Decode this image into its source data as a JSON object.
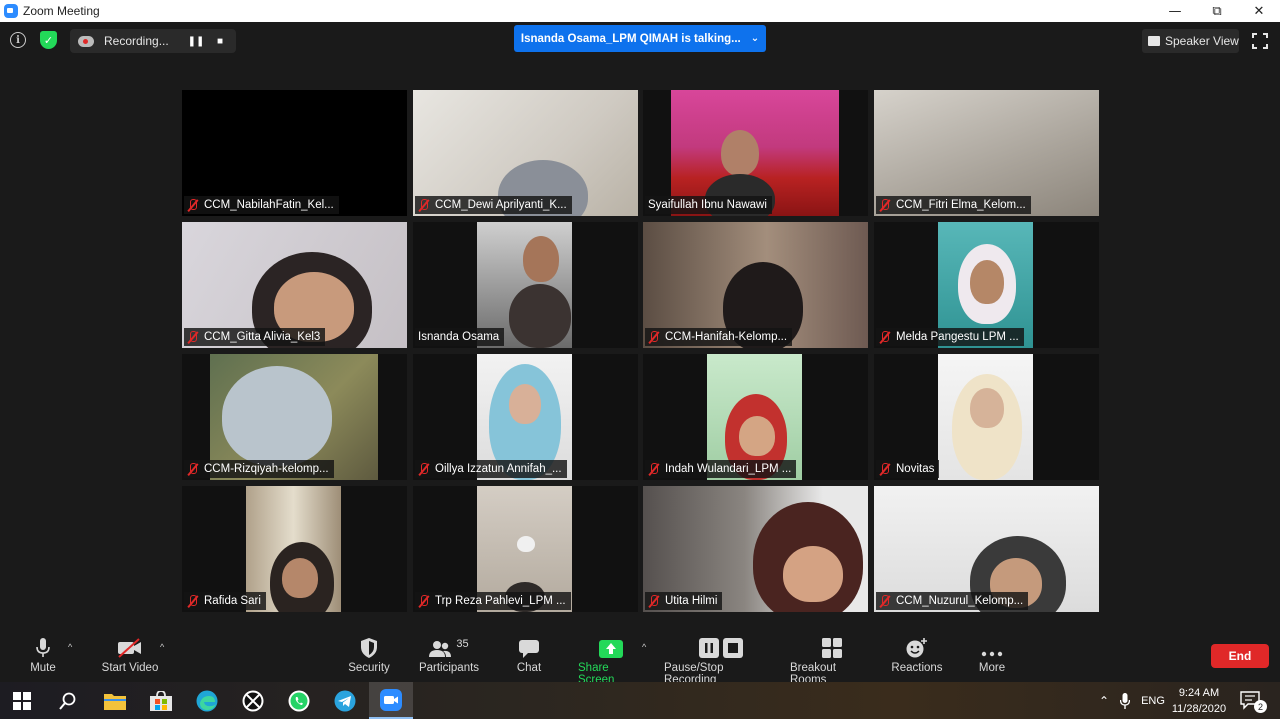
{
  "window": {
    "title": "Zoom Meeting"
  },
  "topbar": {
    "recording_label": "Recording...",
    "talking_banner": "Isnanda Osama_LPM QIMAH is talking...",
    "speaker_view_label": "Speaker View"
  },
  "tiles": [
    {
      "name": "CCM_NabilahFatin_Kel...",
      "muted": true
    },
    {
      "name": "CCM_Dewi Aprilyanti_K...",
      "muted": true
    },
    {
      "name": "Syaifullah Ibnu Nawawi",
      "muted": false
    },
    {
      "name": "CCM_Fitri Elma_Kelom...",
      "muted": true
    },
    {
      "name": "CCM_Gitta Alivia_Kel3",
      "muted": true
    },
    {
      "name": "Isnanda Osama",
      "muted": false
    },
    {
      "name": "CCM-Hanifah-Kelomp...",
      "muted": true
    },
    {
      "name": "Melda Pangestu LPM ...",
      "muted": true
    },
    {
      "name": "CCM-Rizqiyah-kelomp...",
      "muted": true
    },
    {
      "name": "Oillya Izzatun Annifah_...",
      "muted": true
    },
    {
      "name": "Indah Wulandari_LPM ...",
      "muted": true
    },
    {
      "name": "Novitas",
      "muted": true
    },
    {
      "name": "Rafida Sari",
      "muted": true
    },
    {
      "name": "Trp Reza Pahlevi_LPM ...",
      "muted": true
    },
    {
      "name": "Utita Hilmi",
      "muted": true
    },
    {
      "name": "CCM_Nuzurul_Kelomp...",
      "muted": true
    }
  ],
  "toolbar": {
    "mute": "Mute",
    "start_video": "Start Video",
    "security": "Security",
    "participants": "Participants",
    "participants_count": "35",
    "chat": "Chat",
    "share_screen": "Share Screen",
    "pause_stop_recording": "Pause/Stop Recording",
    "breakout_rooms": "Breakout Rooms",
    "reactions": "Reactions",
    "more": "More",
    "end": "End"
  },
  "taskbar": {
    "language": "ENG",
    "time": "9:24 AM",
    "date": "11/28/2020",
    "notification_count": "2"
  },
  "colors": {
    "accent_blue": "#0e72ed",
    "end_red": "#e02828",
    "share_green": "#23d959",
    "meeting_bg": "#1a1a1a"
  }
}
